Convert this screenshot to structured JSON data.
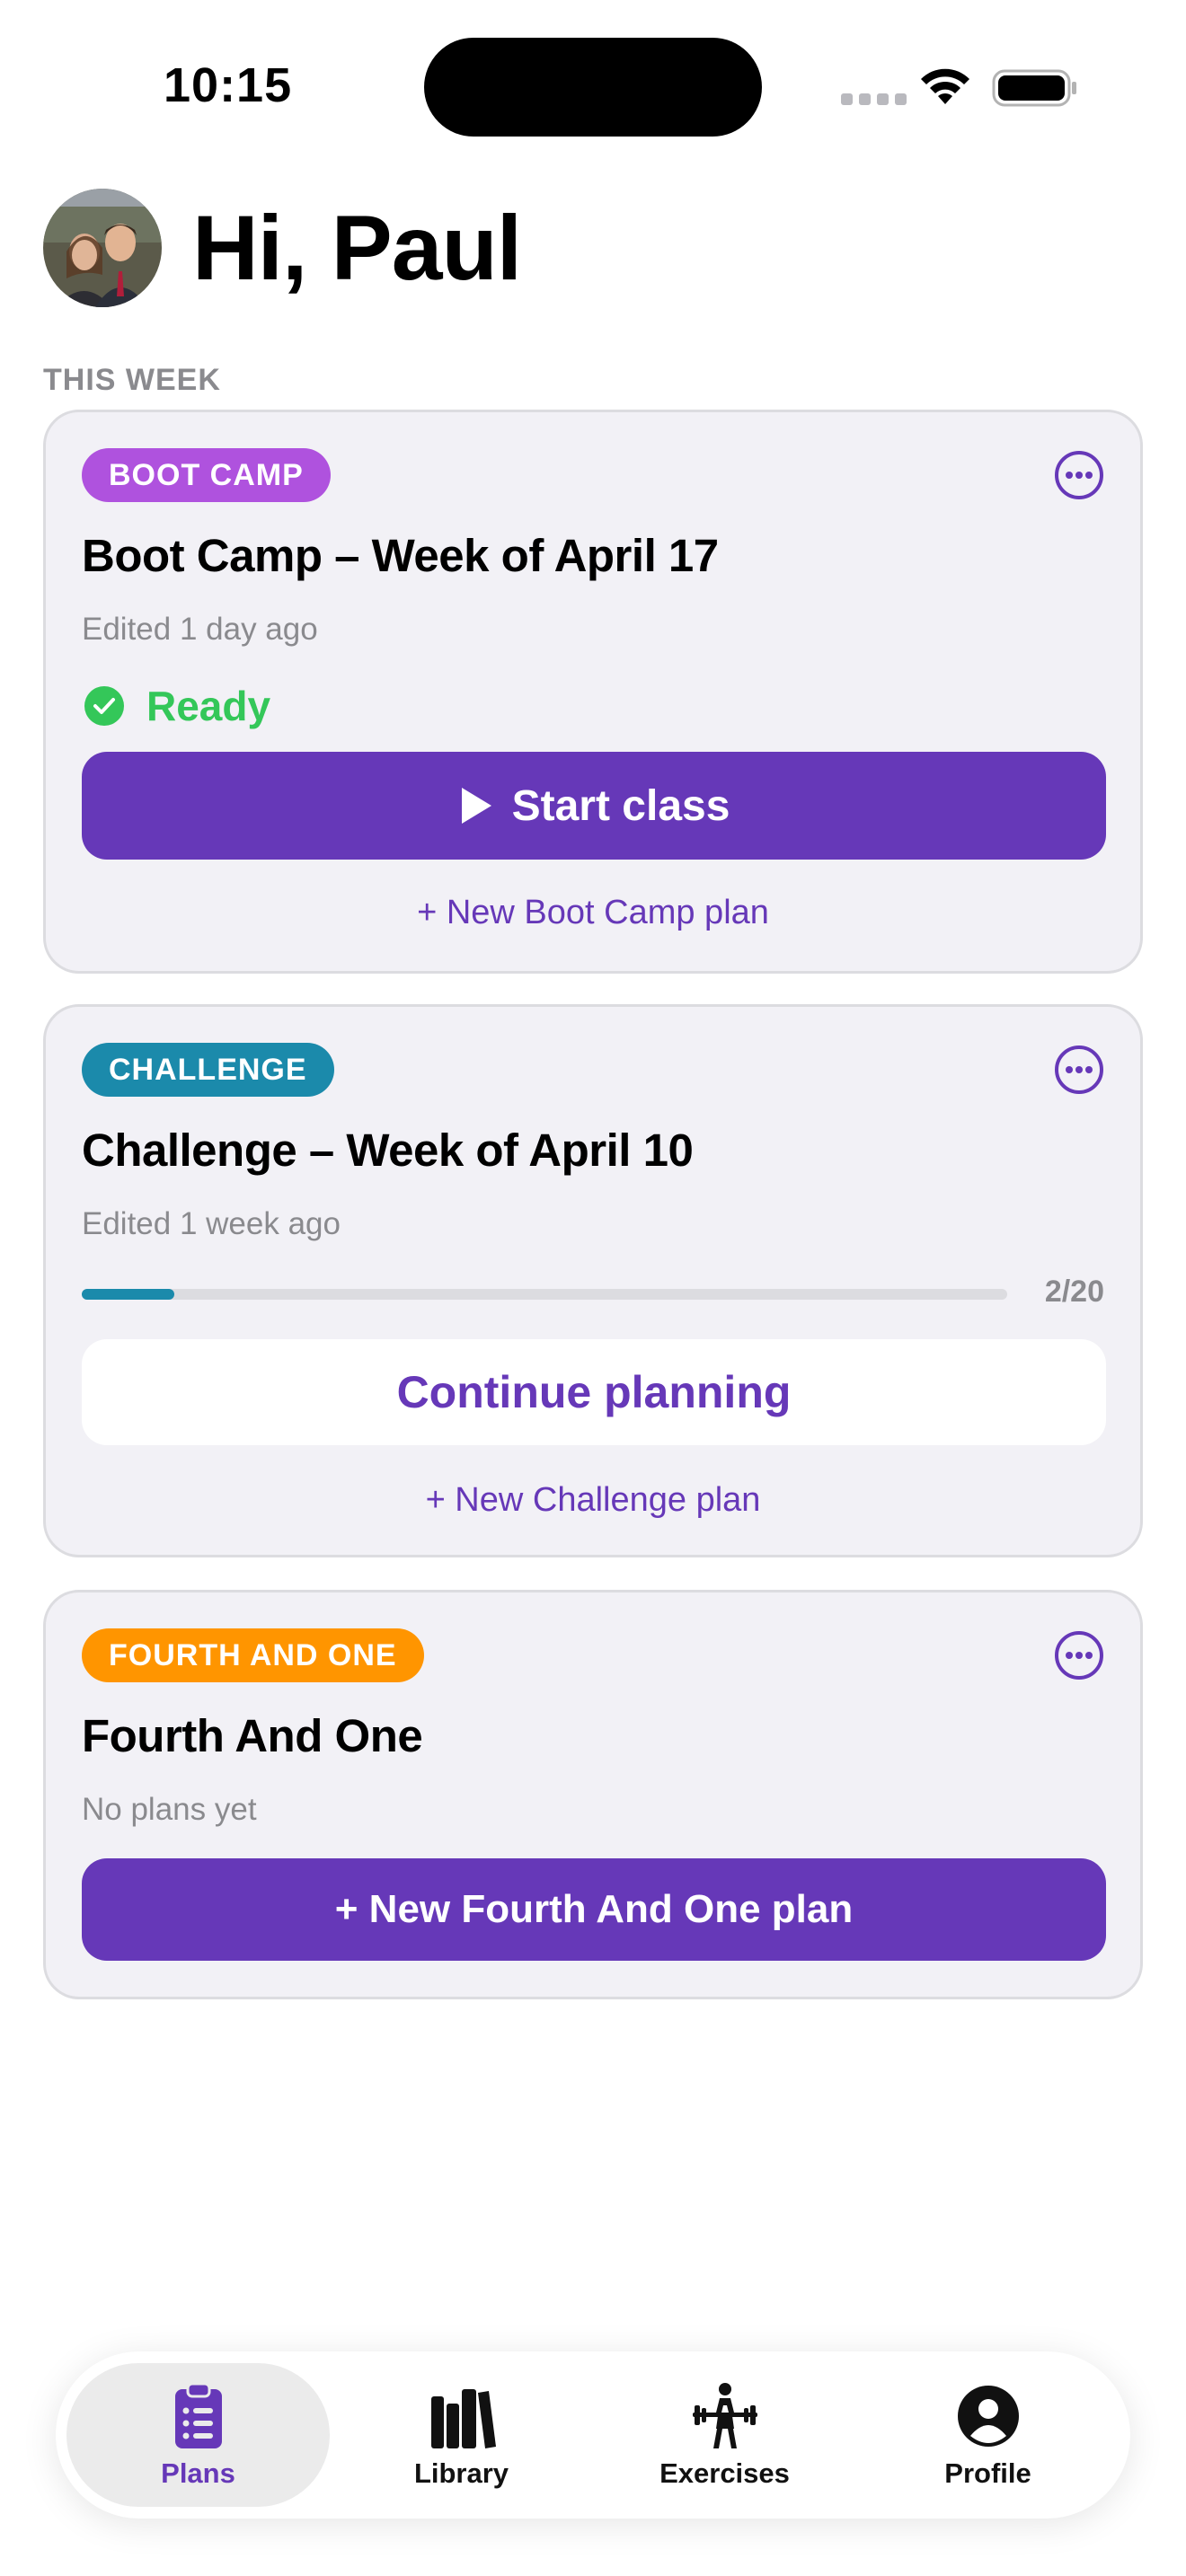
{
  "status_bar": {
    "time": "10:15"
  },
  "header": {
    "greeting": "Hi, Paul"
  },
  "section": {
    "label": "THIS WEEK"
  },
  "cards": [
    {
      "tag": "BOOT CAMP",
      "tag_color": "#af52de",
      "title": "Boot Camp – Week of April 17",
      "subtitle": "Edited 1 day ago",
      "status": "Ready",
      "primary_action": "Start class",
      "link": "+ New Boot Camp plan"
    },
    {
      "tag": "CHALLENGE",
      "tag_color": "#1b8aab",
      "title": "Challenge – Week of April 10",
      "subtitle": "Edited 1 week ago",
      "progress": {
        "done": 2,
        "total": 20,
        "label": "2/20"
      },
      "secondary_action": "Continue planning",
      "link": "+ New Challenge plan"
    },
    {
      "tag": "FOURTH AND ONE",
      "tag_color": "#ff9500",
      "title": "Fourth And One",
      "subtitle": "No plans yet",
      "primary_action": "+ New Fourth And One plan"
    }
  ],
  "tabs": [
    {
      "label": "Plans",
      "icon": "clipboard-list-icon",
      "active": true
    },
    {
      "label": "Library",
      "icon": "books-icon",
      "active": false
    },
    {
      "label": "Exercises",
      "icon": "weightlifter-icon",
      "active": false
    },
    {
      "label": "Profile",
      "icon": "person-circle-icon",
      "active": false
    }
  ],
  "colors": {
    "accent": "#6638b8",
    "ready": "#34c759",
    "card_bg": "#f2f1f6",
    "muted": "#8a8a8e"
  }
}
